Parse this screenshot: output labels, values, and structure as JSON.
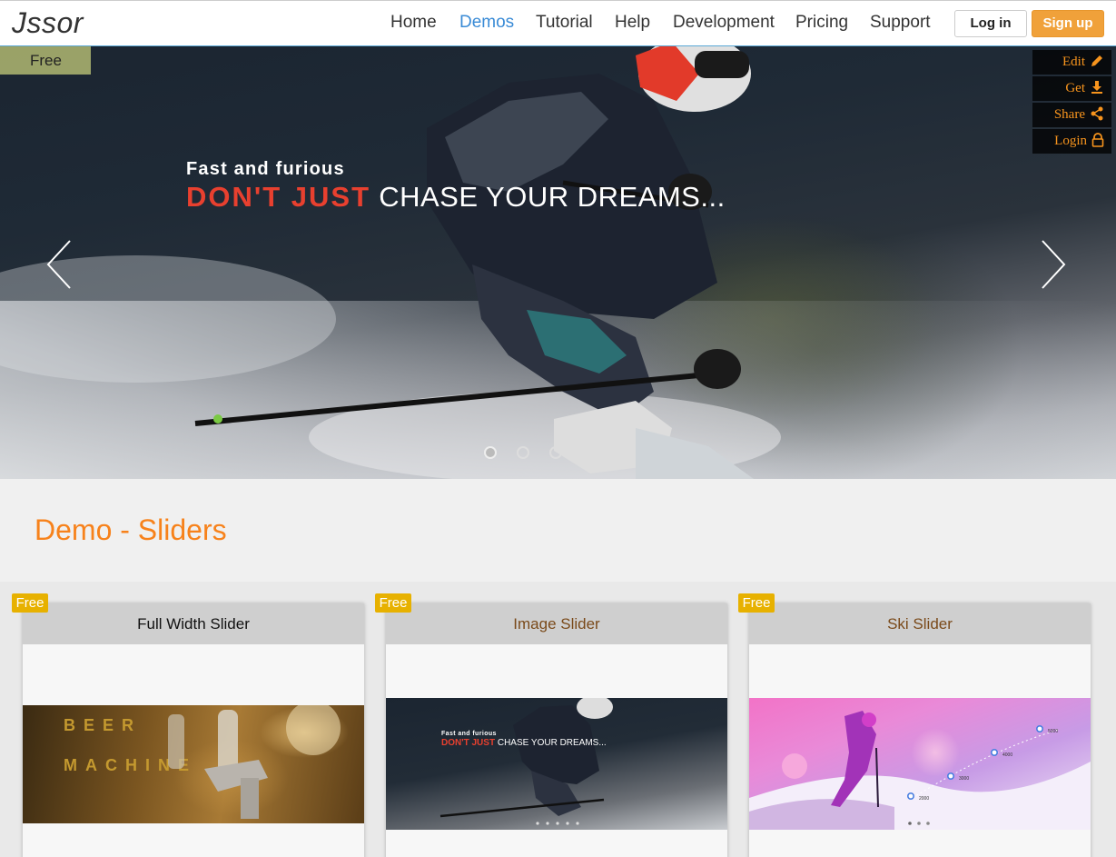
{
  "header": {
    "logo": "Jssor",
    "nav": [
      {
        "label": "Home",
        "active": false
      },
      {
        "label": "Demos",
        "active": true
      },
      {
        "label": "Tutorial",
        "active": false
      },
      {
        "label": "Help",
        "active": false
      },
      {
        "label": "Development",
        "active": false
      },
      {
        "label": "Pricing",
        "active": false
      },
      {
        "label": "Support",
        "active": false
      }
    ],
    "login_label": "Log in",
    "signup_label": "Sign up"
  },
  "hero": {
    "free_label": "Free",
    "tools": [
      {
        "label": "Edit",
        "icon": "pencil-icon"
      },
      {
        "label": "Get",
        "icon": "download-icon"
      },
      {
        "label": "Share",
        "icon": "share-icon"
      },
      {
        "label": "Login",
        "icon": "lock-icon"
      }
    ],
    "caption_small": "Fast and furious",
    "caption_red": "DON'T JUST",
    "caption_white": "CHASE YOUR DREAMS...",
    "bullets_count": 5,
    "active_bullet": 1
  },
  "section": {
    "title": "Demo - Sliders"
  },
  "cards": [
    {
      "title": "Full Width Slider",
      "badge": "Free",
      "thumb_text_1": "BEER",
      "thumb_text_2": "MACHINE"
    },
    {
      "title": "Image Slider",
      "badge": "Free",
      "thumb_small": "Fast and furious",
      "thumb_red": "DON'T JUST",
      "thumb_white": "CHASE YOUR DREAMS..."
    },
    {
      "title": "Ski Slider",
      "badge": "Free",
      "points": [
        "5000",
        "4000",
        "3000",
        "2000"
      ]
    }
  ],
  "colors": {
    "accent_orange": "#f7821b",
    "nav_active": "#3a8bd6",
    "signup_bg": "#f0a13a",
    "badge_yellow": "#e7b100",
    "caption_red": "#e8402f"
  }
}
